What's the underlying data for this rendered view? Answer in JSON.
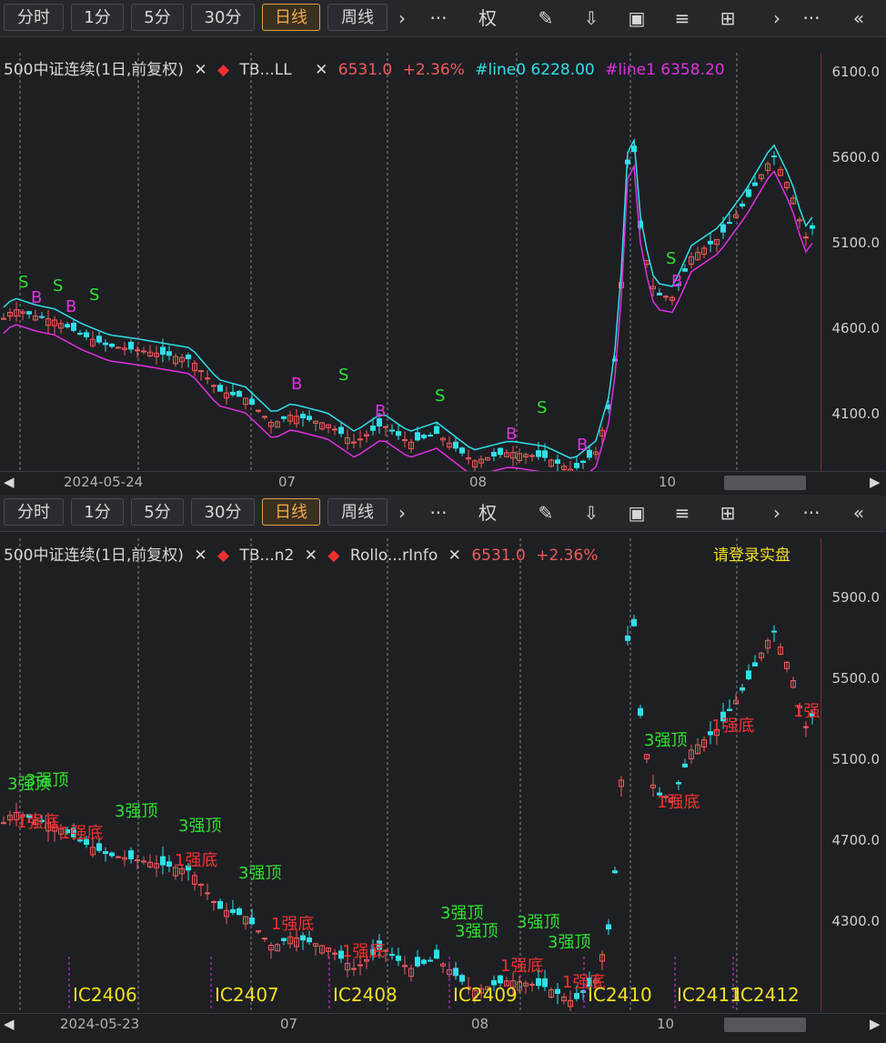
{
  "toolbar": {
    "buttons": [
      "分时",
      "1分",
      "5分",
      "30分",
      "日线",
      "周线"
    ],
    "active": "日线",
    "icons": [
      "chevron-right-icon",
      "more-icon",
      "quan-text",
      "pen-icon",
      "download-icon",
      "chart-icon",
      "sliders-icon",
      "grid-icon",
      "chevron-right-icon",
      "more-icon",
      "double-chevron-left-icon"
    ],
    "quan_label": "权"
  },
  "top": {
    "legend": {
      "symbol": "500中证连续(1日,前复权)",
      "ind1": "TB...LL",
      "close": "6531.0",
      "change": "+2.36%",
      "line0": "#line0 6228.00",
      "line1": "#line1 6358.20"
    },
    "price_labels": [
      "6100.0",
      "5600.0",
      "5100.0",
      "4600.0",
      "4100.0"
    ],
    "x_labels": [
      "2024-05-24",
      "07",
      "08",
      "10"
    ],
    "markers_b": [
      "B",
      "B",
      "B",
      "B",
      "B",
      "B",
      "B",
      "B"
    ],
    "markers_s": [
      "S",
      "S",
      "S",
      "S",
      "S",
      "S",
      "S",
      "S"
    ]
  },
  "bottom": {
    "legend": {
      "symbol": "500中证连续(1日,前复权)",
      "ind1": "TB...n2",
      "ind2": "Rollo...rInfo",
      "close": "6531.0",
      "change": "+2.36%"
    },
    "login": "请登录实盘",
    "price_labels": [
      "5900.0",
      "5500.0",
      "5100.0",
      "4700.0",
      "4300.0"
    ],
    "x_labels": [
      "2024-05-23",
      "07",
      "08",
      "10"
    ],
    "contracts": [
      "IC2406",
      "IC2407",
      "IC2408",
      "IC2409",
      "IC2410",
      "IC2411",
      "IC2412"
    ],
    "top_label": "3强顶",
    "bottom_label": "1强底"
  },
  "colors": {
    "up": "#f05a5a",
    "down": "#2fe0e8",
    "line0": "#2fe0e8",
    "line1": "#e030e0",
    "accent": "#f0a848",
    "signal_green": "#30e030",
    "signal_red": "#f03030",
    "contract": "#f0e020"
  }
}
